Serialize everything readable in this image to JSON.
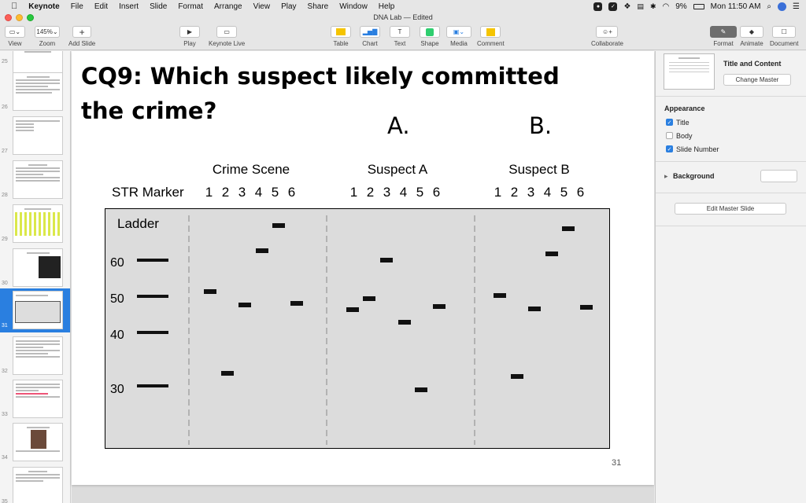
{
  "menubar": {
    "app": "Keynote",
    "items": [
      "File",
      "Edit",
      "Insert",
      "Slide",
      "Format",
      "Arrange",
      "View",
      "Play",
      "Share",
      "Window",
      "Help"
    ],
    "battery": "9%",
    "clock": "Mon 11:50 AM"
  },
  "window": {
    "title": "DNA Lab — Edited"
  },
  "toolbar": {
    "view_label": "View",
    "zoom_value": "145%",
    "zoom_label": "Zoom",
    "add_slide_label": "Add Slide",
    "play_label": "Play",
    "keynote_live_label": "Keynote Live",
    "table_label": "Table",
    "chart_label": "Chart",
    "text_label": "Text",
    "shape_label": "Shape",
    "media_label": "Media",
    "comment_label": "Comment",
    "collaborate_label": "Collaborate",
    "format_label": "Format",
    "animate_label": "Animate",
    "document_label": "Document"
  },
  "navigator": {
    "slides": [
      {
        "num": "25"
      },
      {
        "num": "26"
      },
      {
        "num": "27"
      },
      {
        "num": "28"
      },
      {
        "num": "29"
      },
      {
        "num": "30"
      },
      {
        "num": "31"
      },
      {
        "num": "32"
      },
      {
        "num": "33"
      },
      {
        "num": "34"
      },
      {
        "num": "35"
      }
    ],
    "selected": "31"
  },
  "slide": {
    "title": "CQ9: Which suspect likely committed the crime?",
    "option_a": "A.",
    "option_b": "B.",
    "str_marker_label": "STR Marker",
    "columns": [
      "Crime Scene",
      "Suspect A",
      "Suspect B"
    ],
    "lane_numbers": [
      "1",
      "2",
      "3",
      "4",
      "5",
      "6"
    ],
    "ladder_label": "Ladder",
    "ladder_values": [
      "60",
      "50",
      "40",
      "30"
    ],
    "slide_number": "31"
  },
  "inspector": {
    "master_name": "Title and Content",
    "change_master": "Change Master",
    "appearance": "Appearance",
    "title_label": "Title",
    "body_label": "Body",
    "slide_number_label": "Slide Number",
    "background_label": "Background",
    "edit_master": "Edit Master Slide"
  }
}
